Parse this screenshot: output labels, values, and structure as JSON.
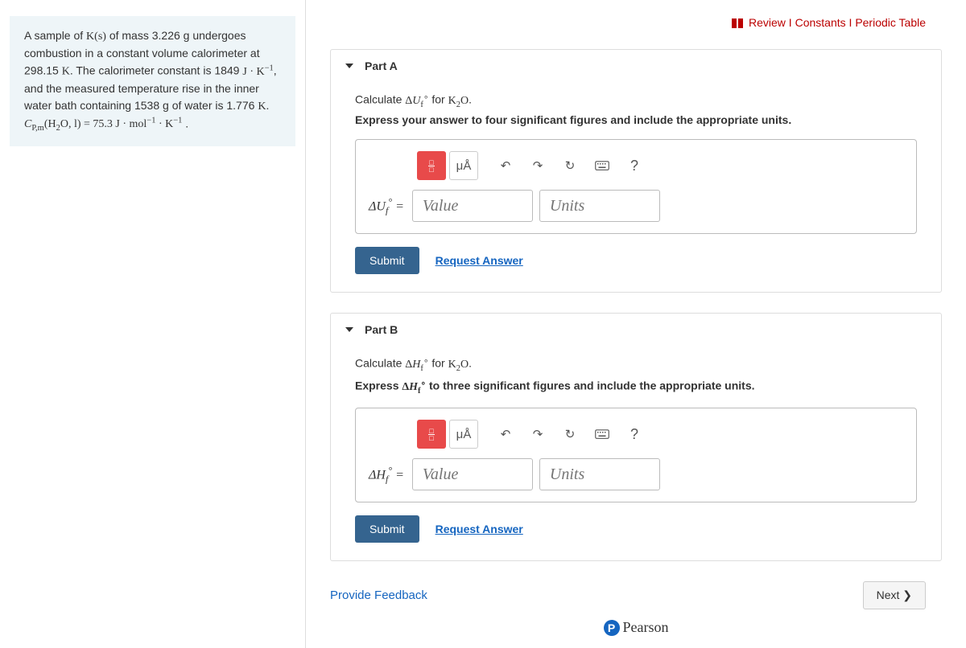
{
  "topLinks": {
    "review": "Review",
    "constants": "Constants",
    "periodic": "Periodic Table"
  },
  "problem": {
    "text_html": "A sample of <span class='formula'>K(s)</span> of mass 3.226 g undergoes combustion in a constant volume calorimeter at 298.15 <span class='formula'>K</span>. The calorimeter constant is 1849 <span class='formula'>J · K<span class='sup'>−1</span></span>, and the measured temperature rise in the inner water bath containing 1538 g of water is 1.776 <span class='formula'>K</span>.<br><span class='formula'><i>C</i><span class='sub'>P,m</span>(H<span class='sub'>2</span>O, l) = 75.3 J · mol<span class='sup'>−1</span> · K<span class='sup'>−1</span></span> ."
  },
  "partA": {
    "title": "Part A",
    "prompt_html": "Calculate <span class='formula'>Δ<i>U</i><span class='sub'>f</span><span class='sup'>∘</span></span> for <span class='formula'>K<span class='sub'>2</span>O</span>.",
    "hint": "Express your answer to four significant figures and include the appropriate units.",
    "varLabel_html": "Δ<i>U</i><span class='sub'>f</span><span class='sup'>°</span> =",
    "valuePlaceholder": "Value",
    "unitsPlaceholder": "Units",
    "submit": "Submit",
    "request": "Request Answer"
  },
  "partB": {
    "title": "Part B",
    "prompt_html": "Calculate <span class='formula'>Δ<i>H</i><span class='sub'>f</span><span class='sup'>∘</span></span> for <span class='formula'>K<span class='sub'>2</span>O</span>.",
    "hint_html": "Express <span class='formula'>Δ<i>H</i><span class='sub'>f</span><span class='sup'>∘</span></span> to three significant figures and include the appropriate units.",
    "varLabel_html": "Δ<i>H</i><span class='sub'>f</span><span class='sup'>°</span> =",
    "valuePlaceholder": "Value",
    "unitsPlaceholder": "Units",
    "submit": "Submit",
    "request": "Request Answer"
  },
  "toolbar": {
    "ua": "μÅ",
    "help": "?"
  },
  "footer": {
    "feedback": "Provide Feedback",
    "next": "Next ❯",
    "pearson": "Pearson"
  }
}
